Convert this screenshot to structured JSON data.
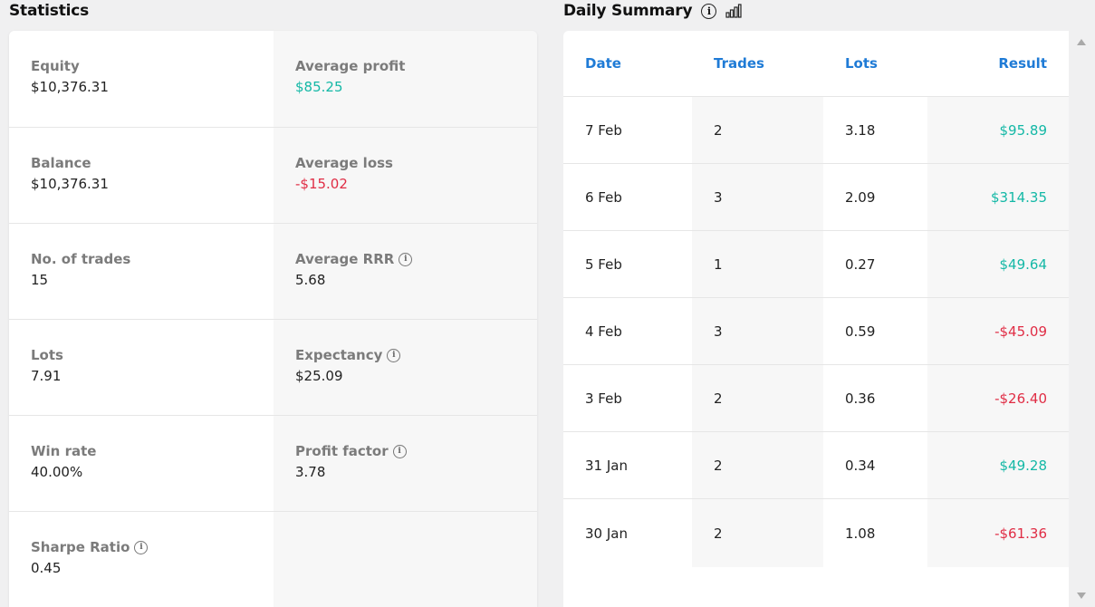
{
  "statistics": {
    "title": "Statistics",
    "rows": [
      {
        "left": {
          "label": "Equity",
          "value": "$10,376.31",
          "info": false
        },
        "right": {
          "label": "Average profit",
          "value": "$85.25",
          "tone": "pos",
          "info": false
        }
      },
      {
        "left": {
          "label": "Balance",
          "value": "$10,376.31",
          "info": false
        },
        "right": {
          "label": "Average loss",
          "value": "-$15.02",
          "tone": "neg",
          "info": false
        }
      },
      {
        "left": {
          "label": "No. of trades",
          "value": "15",
          "info": false
        },
        "right": {
          "label": "Average RRR",
          "value": "5.68",
          "tone": "neutral",
          "info": true
        }
      },
      {
        "left": {
          "label": "Lots",
          "value": "7.91",
          "info": false
        },
        "right": {
          "label": "Expectancy",
          "value": "$25.09",
          "tone": "neutral",
          "info": true
        }
      },
      {
        "left": {
          "label": "Win rate",
          "value": "40.00%",
          "info": false
        },
        "right": {
          "label": "Profit factor",
          "value": "3.78",
          "tone": "neutral",
          "info": true
        }
      },
      {
        "left": {
          "label": "Sharpe Ratio",
          "value": "0.45",
          "info": true
        }
      }
    ]
  },
  "daily_summary": {
    "title": "Daily Summary",
    "info_icon": "info-icon",
    "chart_icon": "bar-chart-icon",
    "headers": {
      "date": "Date",
      "trades": "Trades",
      "lots": "Lots",
      "result": "Result"
    },
    "rows": [
      {
        "date": "7 Feb",
        "trades": "2",
        "lots": "3.18",
        "result": "$95.89",
        "tone": "pos"
      },
      {
        "date": "6 Feb",
        "trades": "3",
        "lots": "2.09",
        "result": "$314.35",
        "tone": "pos"
      },
      {
        "date": "5 Feb",
        "trades": "1",
        "lots": "0.27",
        "result": "$49.64",
        "tone": "pos"
      },
      {
        "date": "4 Feb",
        "trades": "3",
        "lots": "0.59",
        "result": "-$45.09",
        "tone": "neg"
      },
      {
        "date": "3 Feb",
        "trades": "2",
        "lots": "0.36",
        "result": "-$26.40",
        "tone": "neg"
      },
      {
        "date": "31 Jan",
        "trades": "2",
        "lots": "0.34",
        "result": "$49.28",
        "tone": "pos"
      },
      {
        "date": "30 Jan",
        "trades": "2",
        "lots": "1.08",
        "result": "-$61.36",
        "tone": "neg"
      }
    ]
  },
  "colors": {
    "positive": "#14b8a6",
    "negative": "#e02d45",
    "header_blue": "#1f7bd6"
  }
}
